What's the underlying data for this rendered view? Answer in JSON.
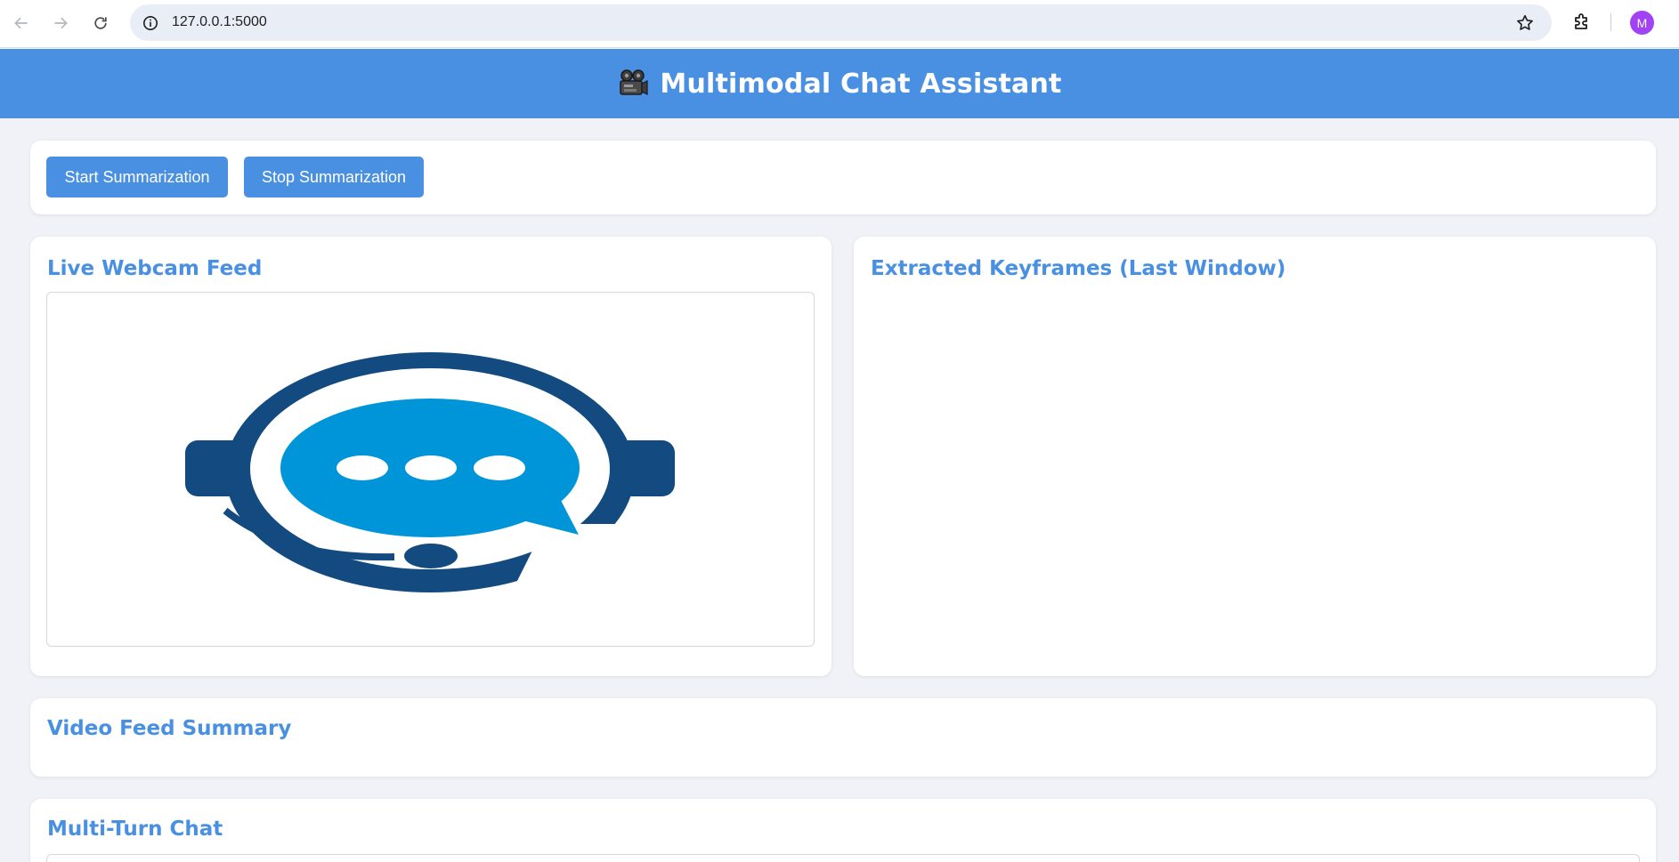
{
  "browser": {
    "url": "127.0.0.1:5000",
    "avatar_initial": "M",
    "icons": [
      "back-arrow-icon",
      "forward-arrow-icon",
      "reload-icon",
      "info-icon",
      "star-icon",
      "extensions-icon"
    ]
  },
  "header": {
    "title": "Multimodal Chat Assistant",
    "icon": "video-camera-icon",
    "background": "#4a90e2"
  },
  "controls": {
    "start_label": "Start Summarization",
    "stop_label": "Stop Summarization"
  },
  "webcam": {
    "title": "Live Webcam Feed",
    "image": "chat-support-headset-logo"
  },
  "keyframes": {
    "title": "Extracted Keyframes (Last Window)"
  },
  "summary": {
    "title": "Video Feed Summary"
  },
  "chat": {
    "title": "Multi-Turn Chat"
  },
  "colors": {
    "accent": "#4a90e2",
    "logo_dark": "#134b80",
    "logo_light": "#0095d9",
    "page_bg": "#f0f2f7"
  }
}
